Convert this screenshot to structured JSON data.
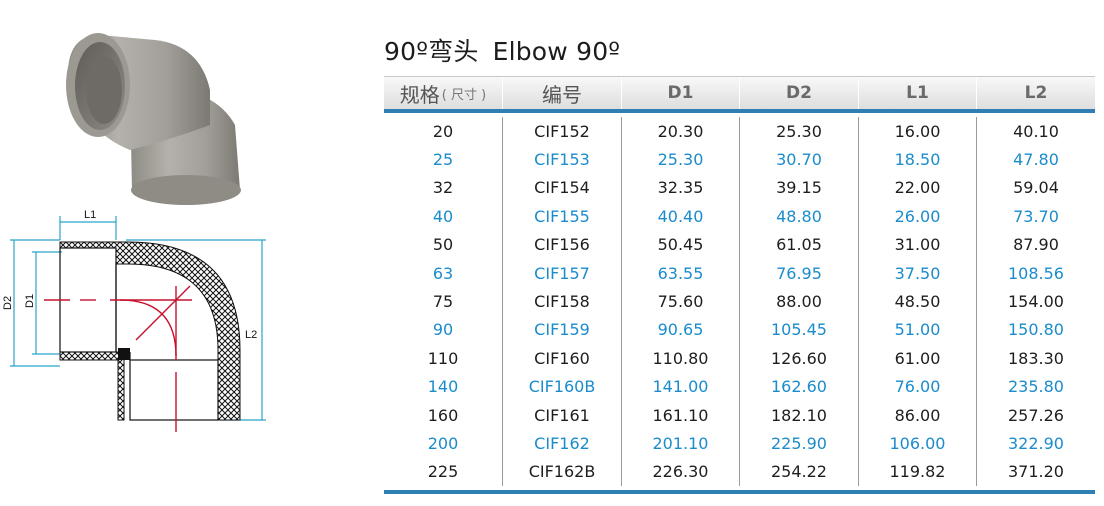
{
  "title": {
    "prefix": "90º弯头",
    "en": "Elbow 90º"
  },
  "drawing_labels": {
    "l1": "L1",
    "d1": "D1",
    "d2": "D2",
    "l2": "L2"
  },
  "colors": {
    "accent_blue": "#2f7fb5",
    "row_blue_text": "#1a8ccc",
    "hatch_red": "#c8102e"
  },
  "table": {
    "headers": {
      "spec": "规格",
      "spec_sub": "( 尺寸 )",
      "code": "编号",
      "d1": "D1",
      "d2": "D2",
      "l1": "L1",
      "l2": "L2"
    },
    "rows": [
      {
        "spec": "20",
        "code": "CIF152",
        "d1": "20.30",
        "d2": "25.30",
        "l1": "16.00",
        "l2": "40.10",
        "style": "black"
      },
      {
        "spec": "25",
        "code": "CIF153",
        "d1": "25.30",
        "d2": "30.70",
        "l1": "18.50",
        "l2": "47.80",
        "style": "blue"
      },
      {
        "spec": "32",
        "code": "CIF154",
        "d1": "32.35",
        "d2": "39.15",
        "l1": "22.00",
        "l2": "59.04",
        "style": "black"
      },
      {
        "spec": "40",
        "code": "CIF155",
        "d1": "40.40",
        "d2": "48.80",
        "l1": "26.00",
        "l2": "73.70",
        "style": "blue"
      },
      {
        "spec": "50",
        "code": "CIF156",
        "d1": "50.45",
        "d2": "61.05",
        "l1": "31.00",
        "l2": "87.90",
        "style": "black"
      },
      {
        "spec": "63",
        "code": "CIF157",
        "d1": "63.55",
        "d2": "76.95",
        "l1": "37.50",
        "l2": "108.56",
        "style": "blue"
      },
      {
        "spec": "75",
        "code": "CIF158",
        "d1": "75.60",
        "d2": "88.00",
        "l1": "48.50",
        "l2": "154.00",
        "style": "black"
      },
      {
        "spec": "90",
        "code": "CIF159",
        "d1": "90.65",
        "d2": "105.45",
        "l1": "51.00",
        "l2": "150.80",
        "style": "blue"
      },
      {
        "spec": "110",
        "code": "CIF160",
        "d1": "110.80",
        "d2": "126.60",
        "l1": "61.00",
        "l2": "183.30",
        "style": "black"
      },
      {
        "spec": "140",
        "code": "CIF160B",
        "d1": "141.00",
        "d2": "162.60",
        "l1": "76.00",
        "l2": "235.80",
        "style": "blue"
      },
      {
        "spec": "160",
        "code": "CIF161",
        "d1": "161.10",
        "d2": "182.10",
        "l1": "86.00",
        "l2": "257.26",
        "style": "black"
      },
      {
        "spec": "200",
        "code": "CIF162",
        "d1": "201.10",
        "d2": "225.90",
        "l1": "106.00",
        "l2": "322.90",
        "style": "blue"
      },
      {
        "spec": "225",
        "code": "CIF162B",
        "d1": "226.30",
        "d2": "254.22",
        "l1": "119.82",
        "l2": "371.20",
        "style": "black"
      }
    ]
  }
}
